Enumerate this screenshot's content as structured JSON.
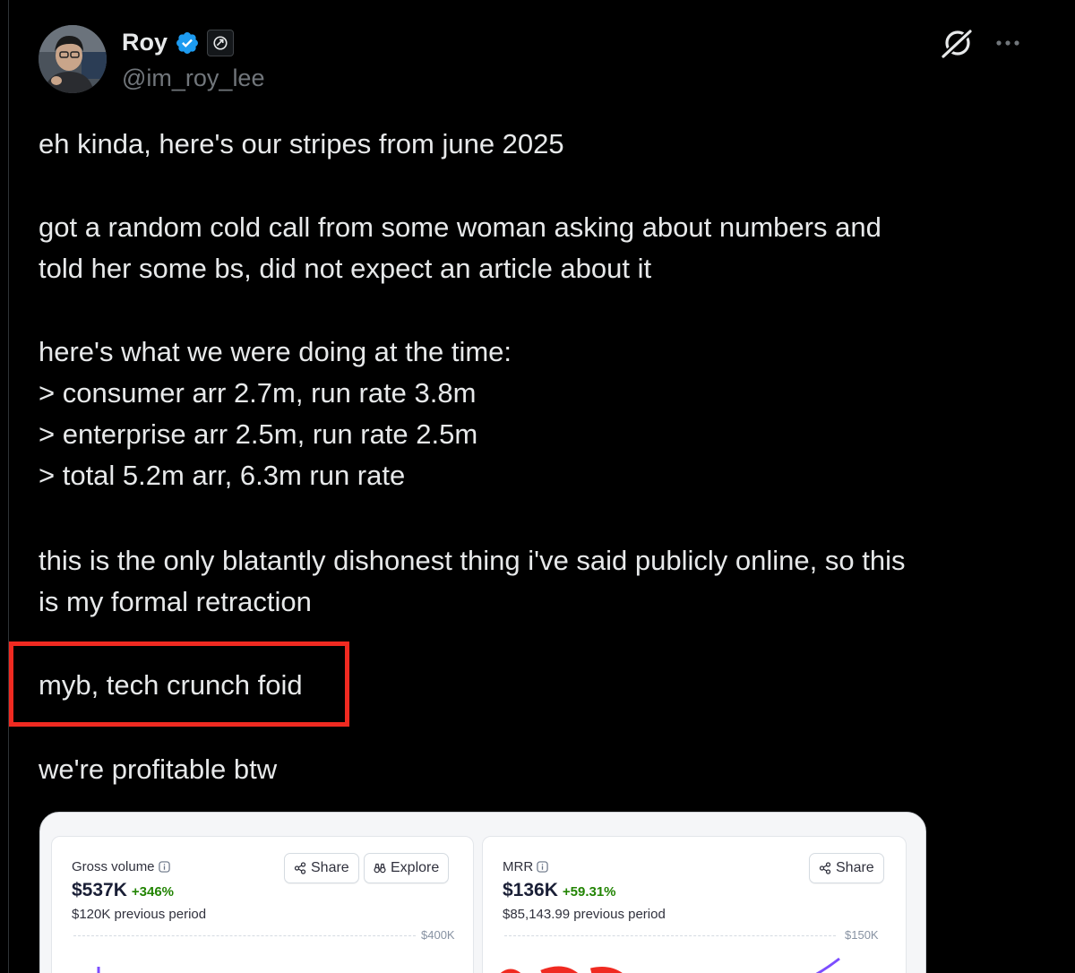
{
  "author": {
    "display_name": "Roy",
    "handle": "@im_roy_lee",
    "verified": true,
    "avatar_icon": "avatar-photo"
  },
  "actions": {
    "grok_icon": "grok-icon",
    "more_icon": "more-icon"
  },
  "tweet": {
    "paragraphs": [
      [
        "eh kinda, here's our stripes from june 2025"
      ],
      [
        "got a random cold call from some woman asking about numbers and",
        "told her some bs, did not expect an article about it"
      ],
      [
        "here's what we were doing at the time:",
        "> consumer arr 2.7m, run rate 3.8m",
        "> enterprise arr 2.5m, run rate 2.5m",
        "> total 5.2m arr, 6.3m run rate"
      ],
      [
        "this is the only blatantly dishonest thing i've said publicly online, so this",
        "is my formal retraction"
      ],
      [
        "myb, tech crunch foid"
      ],
      [
        "we're profitable btw"
      ]
    ]
  },
  "colors": {
    "background": "#000000",
    "text": "#e7e9ea",
    "muted": "#71767b",
    "highlight_border": "#f02a21",
    "verified_blue": "#1d9bf0",
    "positive_green": "#228403"
  },
  "media": {
    "panels": [
      {
        "title": "Gross volume",
        "value": "$537K",
        "change": "+346%",
        "previous": "$120K previous period",
        "axis_label": "$400K",
        "buttons": [
          {
            "label": "Share",
            "icon": "share-icon"
          },
          {
            "label": "Explore",
            "icon": "binoculars-icon"
          }
        ]
      },
      {
        "title": "MRR",
        "value": "$136K",
        "change": "+59.31%",
        "previous": "$85,143.99 previous period",
        "axis_label": "$150K",
        "buttons": [
          {
            "label": "Share",
            "icon": "share-icon"
          }
        ]
      }
    ]
  }
}
